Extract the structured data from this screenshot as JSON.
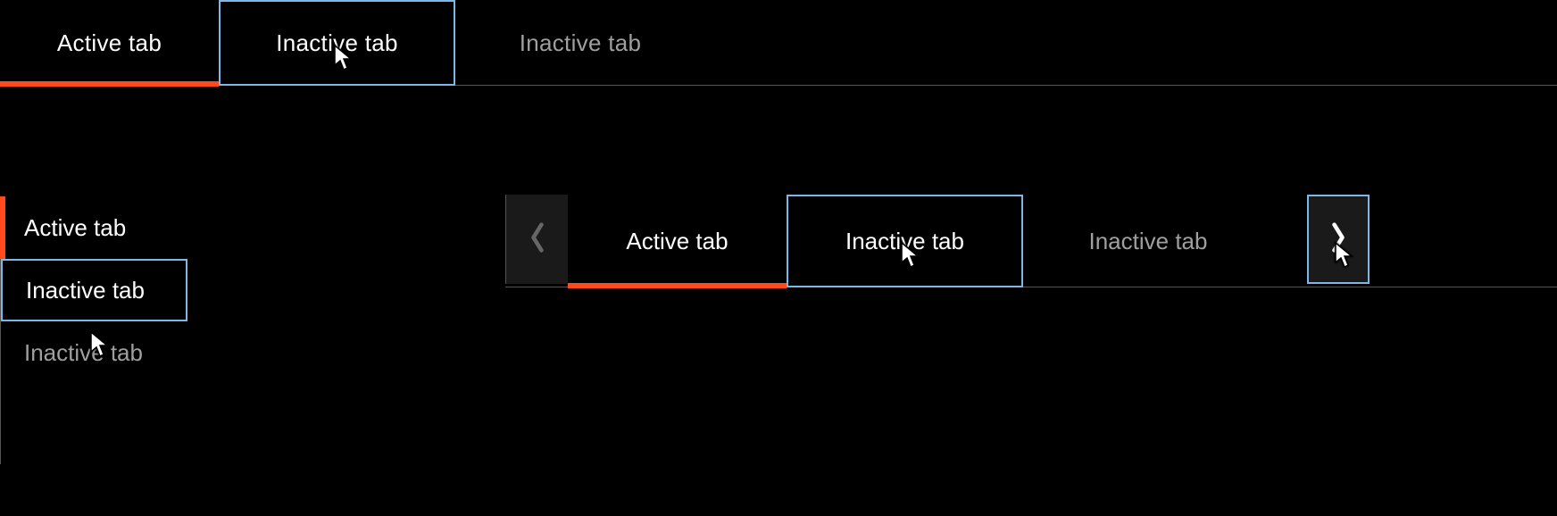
{
  "colors": {
    "accent": "#ff4a1c",
    "focus_outline": "#7db7e8",
    "text_active": "#ffffff",
    "text_idle": "#9f9f9f",
    "panel": "#1a1a1a"
  },
  "horizontal_tabs": {
    "items": [
      {
        "label": "Active tab",
        "state": "active"
      },
      {
        "label": "Inactive tab",
        "state": "hover"
      },
      {
        "label": "Inactive tab",
        "state": "idle"
      }
    ]
  },
  "vertical_tabs": {
    "items": [
      {
        "label": "Active tab",
        "state": "active"
      },
      {
        "label": "Inactive tab",
        "state": "hover"
      },
      {
        "label": "Inactive tab",
        "state": "idle"
      }
    ]
  },
  "scroll_tabs": {
    "prev_icon": "chevron-left",
    "next_icon": "chevron-right",
    "next_state": "hover",
    "items": [
      {
        "label": "Active tab",
        "state": "active"
      },
      {
        "label": "Inactive tab",
        "state": "hover"
      },
      {
        "label": "Inactive tab",
        "state": "idle"
      }
    ]
  }
}
